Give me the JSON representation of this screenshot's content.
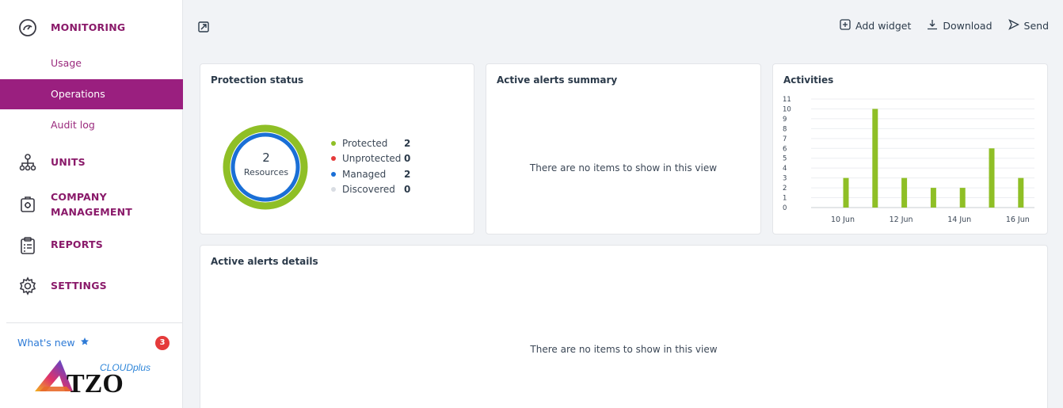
{
  "sidebar": {
    "sections": [
      {
        "label": "MONITORING",
        "icon": "gauge-icon"
      },
      {
        "label": "UNITS",
        "icon": "hierarchy-icon"
      },
      {
        "label": "COMPANY\nMANAGEMENT",
        "icon": "building-icon"
      },
      {
        "label": "REPORTS",
        "icon": "clipboard-icon"
      },
      {
        "label": "SETTINGS",
        "icon": "gear-icon"
      }
    ],
    "monitoring_items": [
      {
        "label": "Usage",
        "active": false
      },
      {
        "label": "Operations",
        "active": true
      },
      {
        "label": "Audit log",
        "active": false
      }
    ],
    "whats_new": "What's new",
    "whats_new_badge": "3",
    "logo_text": "TZO",
    "logo_super": "CLOUDplus"
  },
  "toolbar": {
    "add_widget": "Add widget",
    "download": "Download",
    "send": "Send"
  },
  "widgets": {
    "protection": {
      "title": "Protection status",
      "center_value": "2",
      "center_label": "Resources",
      "legend": [
        {
          "label": "Protected",
          "value": "2",
          "color": "#8fbf26"
        },
        {
          "label": "Unprotected",
          "value": "0",
          "color": "#e53a3a"
        },
        {
          "label": "Managed",
          "value": "2",
          "color": "#1a6fd6"
        },
        {
          "label": "Discovered",
          "value": "0",
          "color": "#d9dde3"
        }
      ]
    },
    "alerts_summary": {
      "title": "Active alerts summary",
      "empty": "There are no items to show in this view"
    },
    "activities": {
      "title": "Activities"
    },
    "alerts_details": {
      "title": "Active alerts details",
      "empty": "There are no items to show in this view"
    }
  },
  "chart_data": {
    "type": "bar",
    "categories": [
      "10 Jun",
      "11 Jun",
      "12 Jun",
      "13 Jun",
      "14 Jun",
      "15 Jun",
      "16 Jun"
    ],
    "tick_labels": [
      "10 Jun",
      "12 Jun",
      "14 Jun",
      "16 Jun"
    ],
    "values": [
      3,
      10,
      3,
      2,
      2,
      6,
      3
    ],
    "ylim": [
      0,
      11
    ],
    "yticks": [
      0,
      1,
      2,
      3,
      4,
      5,
      6,
      7,
      8,
      9,
      10,
      11
    ],
    "color": "#8fbf26",
    "title": "",
    "xlabel": "",
    "ylabel": ""
  }
}
